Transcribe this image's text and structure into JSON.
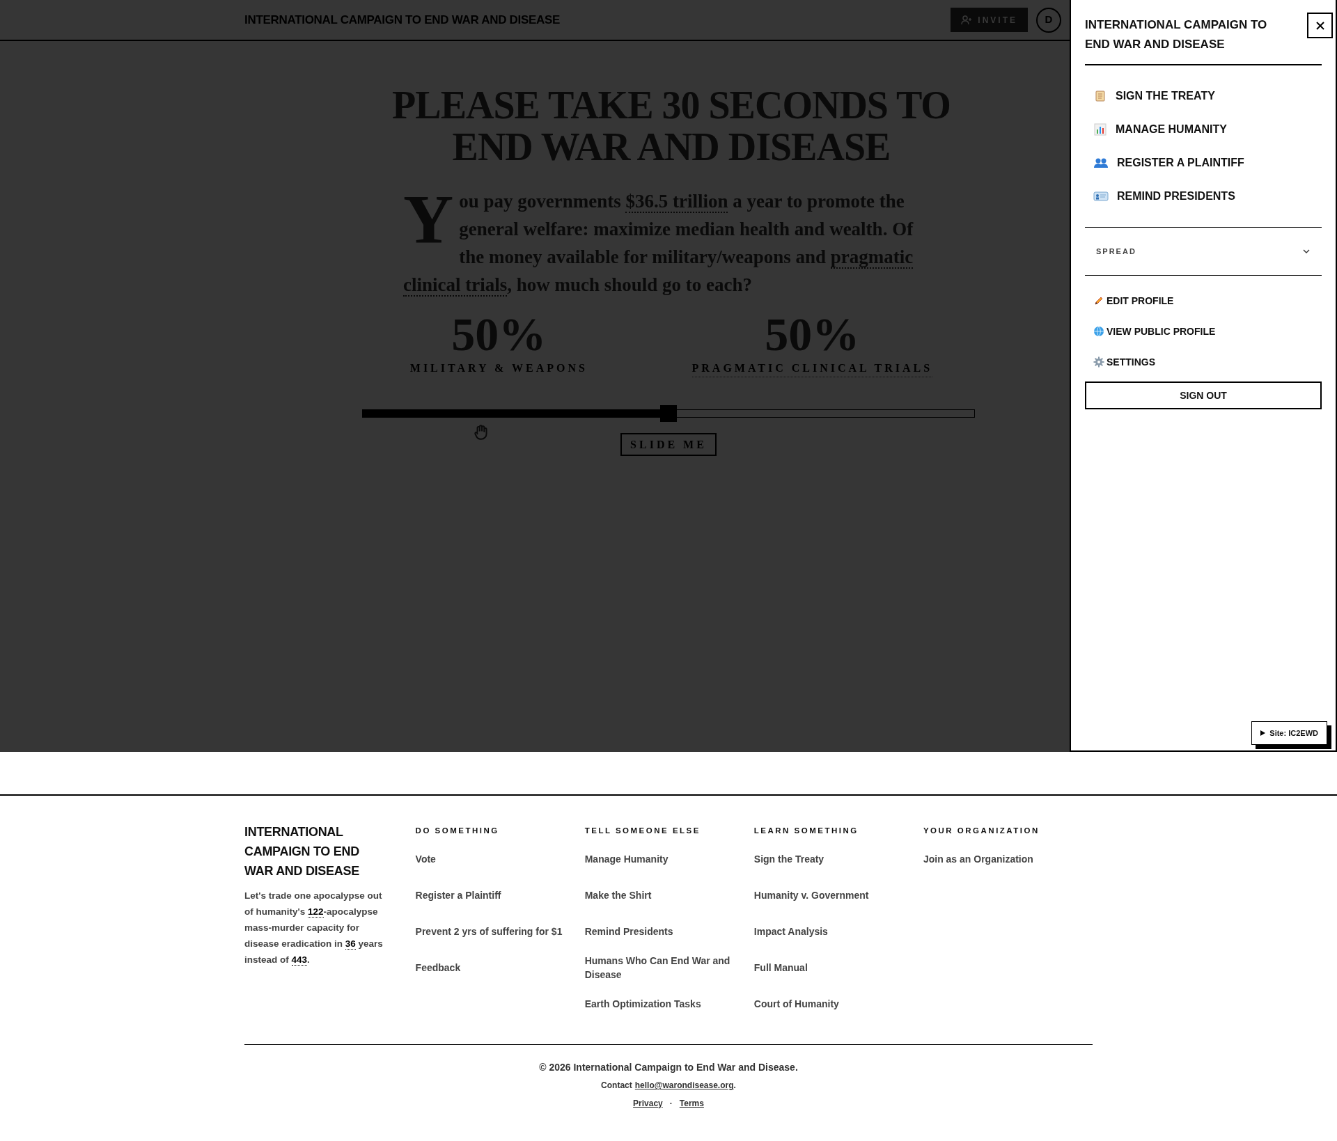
{
  "header": {
    "title": "INTERNATIONAL CAMPAIGN TO END WAR AND DISEASE",
    "invite_button": "INVITE",
    "avatar": "D"
  },
  "hero": {
    "title_lines": [
      "PLEASE TAKE 30 SECONDS TO",
      "END WAR AND DISEASE"
    ],
    "drop_cap": "Y",
    "question": [
      {
        "kind": "plain",
        "text": "ou pay governments "
      },
      {
        "kind": "link",
        "text": "$36.5 trillion"
      },
      {
        "kind": "plain",
        "text": " a year to promote the general welfare: maximize median health and wealth. Of the money available for military/weapons and "
      },
      {
        "kind": "link",
        "text": "pragmatic clinical trials"
      },
      {
        "kind": "plain",
        "text": ", how much should go to each?"
      }
    ],
    "allocations": [
      {
        "kind": "plain",
        "value": "50%",
        "label": "MILITARY & WEAPONS"
      },
      {
        "kind": "link",
        "value": "50%",
        "label": "PRAGMATIC CLINICAL TRIALS"
      }
    ],
    "slider": {
      "level": 0.5,
      "button": "SLIDE ME"
    }
  },
  "sidebar": {
    "title": "INTERNATIONAL CAMPAIGN TO END WAR AND DISEASE",
    "nav_items": [
      "SIGN THE TREATY",
      "MANAGE HUMANITY",
      "REGISTER A PLAINTIFF",
      "REMIND PRESIDENTS"
    ],
    "spread": {
      "label": "SPREAD",
      "expanded": false
    },
    "profile_links": [
      "EDIT PROFILE",
      "VIEW PUBLIC PROFILE",
      "SETTINGS"
    ],
    "sign_out_button": "SIGN OUT",
    "site_badge": "Site: IC2EWD"
  },
  "footer": {
    "brand": {
      "title": "INTERNATIONAL CAMPAIGN TO END WAR AND DISEASE",
      "blurb": [
        {
          "kind": "plain",
          "text": "Let's trade one apocalypse out of humanity's "
        },
        {
          "kind": "number",
          "text": "122"
        },
        {
          "kind": "plain",
          "text": "-apocalypse mass-murder capacity for disease eradication in "
        },
        {
          "kind": "number",
          "text": "36"
        },
        {
          "kind": "plain",
          "text": " years instead of "
        },
        {
          "kind": "number",
          "text": "443"
        },
        {
          "kind": "plain",
          "text": "."
        }
      ]
    },
    "columns": [
      {
        "heading": "DO SOMETHING",
        "links": [
          "Vote",
          "Register a Plaintiff",
          "Prevent 2 yrs of suffering for $1",
          "Feedback"
        ]
      },
      {
        "heading": "TELL SOMEONE ELSE",
        "links": [
          "Manage Humanity",
          "Make the Shirt",
          "Remind Presidents",
          "Humans Who Can End War and Disease",
          "Earth Optimization Tasks"
        ]
      },
      {
        "heading": "LEARN SOMETHING",
        "links": [
          "Sign the Treaty",
          "Humanity v. Government",
          "Impact Analysis",
          "Full Manual",
          "Court of Humanity"
        ]
      },
      {
        "heading": "YOUR ORGANIZATION",
        "links": [
          "Join as an Organization"
        ]
      }
    ],
    "copyright": "© 2026 International Campaign to End War and Disease.",
    "contact": {
      "prefix": "Contact",
      "email": "hello@warondisease.org",
      "suffix": "."
    },
    "legal_links": [
      "Privacy",
      "Terms"
    ],
    "separator": "·"
  }
}
